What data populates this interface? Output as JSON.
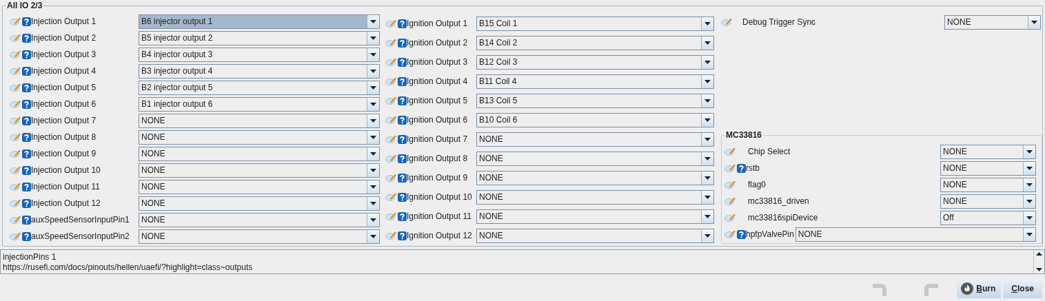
{
  "panel": {
    "title": "All IO 2/3"
  },
  "injection": [
    {
      "label": "Injection Output 1",
      "help": true,
      "value": "B6 injector output 1",
      "selected": true
    },
    {
      "label": "Injection Output 2",
      "help": true,
      "value": "B5 injector output 2",
      "selected": false
    },
    {
      "label": "Injection Output 3",
      "help": true,
      "value": "B4 injector output 3",
      "selected": false
    },
    {
      "label": "Injection Output 4",
      "help": true,
      "value": "B3 injector output 4",
      "selected": false
    },
    {
      "label": "Injection Output 5",
      "help": true,
      "value": "B2 injector output 5",
      "selected": false
    },
    {
      "label": "Injection Output 6",
      "help": true,
      "value": "B1 injector output 6",
      "selected": false
    },
    {
      "label": "Injection Output 7",
      "help": true,
      "value": "NONE",
      "selected": false
    },
    {
      "label": "Injection Output 8",
      "help": true,
      "value": "NONE",
      "selected": false
    },
    {
      "label": "Injection Output 9",
      "help": true,
      "value": "NONE",
      "selected": false
    },
    {
      "label": "Injection Output 10",
      "help": true,
      "value": "NONE",
      "selected": false
    },
    {
      "label": "Injection Output 11",
      "help": true,
      "value": "NONE",
      "selected": false
    },
    {
      "label": "Injection Output 12",
      "help": true,
      "value": "NONE",
      "selected": false
    },
    {
      "label": "auxSpeedSensorInputPin1",
      "help": true,
      "value": "NONE",
      "selected": false
    },
    {
      "label": "auxSpeedSensorInputPin2",
      "help": true,
      "value": "NONE",
      "selected": false
    }
  ],
  "ignition": [
    {
      "label": "Ignition Output 1",
      "help": true,
      "value": "B15 Coil 1",
      "selected": false
    },
    {
      "label": "Ignition Output 2",
      "help": true,
      "value": "B14 Coil 2",
      "selected": false
    },
    {
      "label": "Ignition Output 3",
      "help": true,
      "value": "B12 Coil 3",
      "selected": false
    },
    {
      "label": "Ignition Output 4",
      "help": true,
      "value": "B11 Coil 4",
      "selected": false
    },
    {
      "label": "Ignition Output 5",
      "help": true,
      "value": "B13 Coil 5",
      "selected": false
    },
    {
      "label": "Ignition Output 6",
      "help": true,
      "value": "B10 Coil 6",
      "selected": false
    },
    {
      "label": "Ignition Output 7",
      "help": true,
      "value": "NONE",
      "selected": false
    },
    {
      "label": "Ignition Output 8",
      "help": true,
      "value": "NONE",
      "selected": false
    },
    {
      "label": "Ignition Output 9",
      "help": true,
      "value": "NONE",
      "selected": false
    },
    {
      "label": "Ignition Output 10",
      "help": true,
      "value": "NONE",
      "selected": false
    },
    {
      "label": "Ignition Output 11",
      "help": true,
      "value": "NONE",
      "selected": false
    },
    {
      "label": "Ignition Output 12",
      "help": true,
      "value": "NONE",
      "selected": false
    }
  ],
  "debug": {
    "label": "Debug Trigger Sync",
    "help": false,
    "value": "NONE",
    "selected": false
  },
  "mc33816": {
    "title": "MC33816",
    "fields": [
      {
        "label": "Chip Select",
        "help": false,
        "value": "NONE",
        "selected": false,
        "kind": "fixed"
      },
      {
        "label": "rstb",
        "help": true,
        "value": "NONE",
        "selected": false,
        "kind": "fixed"
      },
      {
        "label": "flag0",
        "help": false,
        "value": "NONE",
        "selected": false,
        "kind": "fixed"
      },
      {
        "label": "mc33816_driven",
        "help": false,
        "value": "NONE",
        "selected": false,
        "kind": "fixed"
      },
      {
        "label": "mc33816spiDevice",
        "help": false,
        "value": "Off",
        "selected": false,
        "kind": "fixed"
      },
      {
        "label": "hpfpValvePin",
        "help": true,
        "value": "NONE",
        "selected": false,
        "kind": "stretch"
      }
    ]
  },
  "description": {
    "lines": [
      "injectionPins 1",
      "https://rusefi.com/docs/pinouts/hellen/uaefi/?highlight=class~outputs"
    ]
  },
  "buttons": [
    {
      "kind": "undo",
      "disabled": true
    },
    {
      "kind": "redo",
      "disabled": true
    },
    {
      "kind": "burn",
      "label": "Burn",
      "underline_first": true
    },
    {
      "kind": "close",
      "label": "Close",
      "underline_first": true
    }
  ]
}
